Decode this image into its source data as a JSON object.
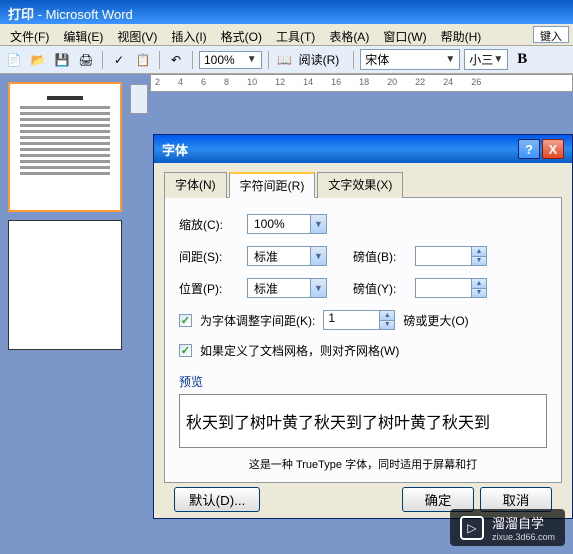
{
  "app": {
    "title_prefix": "打印",
    "title_suffix": "Microsoft Word"
  },
  "menu": {
    "file": "文件(F)",
    "edit": "编辑(E)",
    "view": "视图(V)",
    "insert": "插入(I)",
    "format": "格式(O)",
    "tools": "工具(T)",
    "table": "表格(A)",
    "window": "窗口(W)",
    "help": "帮助(H)",
    "type_hint": "键入"
  },
  "toolbar": {
    "zoom": "100%",
    "reading": "阅读(R)",
    "font_name": "宋体",
    "font_size": "小三",
    "bold": "B"
  },
  "ruler": {
    "marks": [
      "2",
      "4",
      "6",
      "8",
      "10",
      "12",
      "14",
      "16",
      "18",
      "20",
      "22",
      "24",
      "26"
    ]
  },
  "dialog": {
    "title": "字体",
    "close": "X",
    "help": "?",
    "tabs": {
      "font": "字体(N)",
      "spacing": "字符间距(R)",
      "effects": "文字效果(X)"
    },
    "fields": {
      "scale_label": "缩放(C):",
      "scale_value": "100%",
      "spacing_label": "间距(S):",
      "spacing_value": "标准",
      "pound1_label": "磅值(B):",
      "pound1_value": "",
      "position_label": "位置(P):",
      "position_value": "标准",
      "pound2_label": "磅值(Y):",
      "pound2_value": ""
    },
    "checks": {
      "kerning_label": "为字体调整字间距(K):",
      "kerning_value": "1",
      "kerning_suffix": "磅或更大(O)",
      "grid_label": "如果定义了文档网格，则对齐网格(W)"
    },
    "preview": {
      "label": "预览",
      "text": "秋天到了树叶黄了秋天到了树叶黄了秋天到",
      "desc": "这是一种 TrueType 字体，同时适用于屏幕和打"
    },
    "buttons": {
      "default": "默认(D)...",
      "ok": "确定",
      "cancel": "取消"
    }
  },
  "watermark": {
    "brand": "溜溜自学",
    "url": "zixue.3d66.com"
  }
}
